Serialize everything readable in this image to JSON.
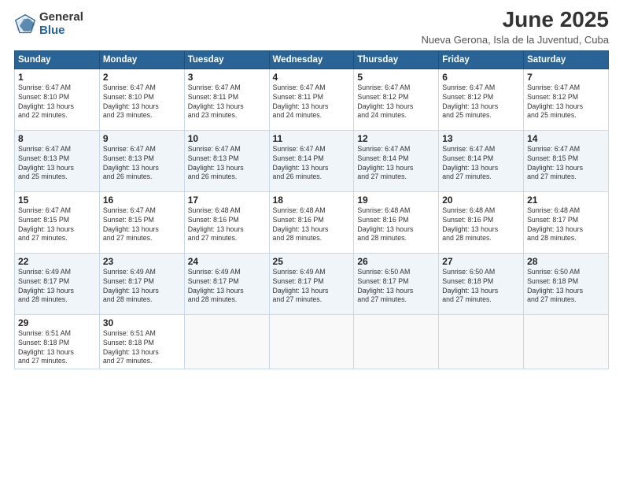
{
  "logo": {
    "general": "General",
    "blue": "Blue"
  },
  "title": "June 2025",
  "subtitle": "Nueva Gerona, Isla de la Juventud, Cuba",
  "days": [
    "Sunday",
    "Monday",
    "Tuesday",
    "Wednesday",
    "Thursday",
    "Friday",
    "Saturday"
  ],
  "weeks": [
    [
      {
        "day": "1",
        "lines": [
          "Sunrise: 6:47 AM",
          "Sunset: 8:10 PM",
          "Daylight: 13 hours",
          "and 22 minutes."
        ]
      },
      {
        "day": "2",
        "lines": [
          "Sunrise: 6:47 AM",
          "Sunset: 8:10 PM",
          "Daylight: 13 hours",
          "and 23 minutes."
        ]
      },
      {
        "day": "3",
        "lines": [
          "Sunrise: 6:47 AM",
          "Sunset: 8:11 PM",
          "Daylight: 13 hours",
          "and 23 minutes."
        ]
      },
      {
        "day": "4",
        "lines": [
          "Sunrise: 6:47 AM",
          "Sunset: 8:11 PM",
          "Daylight: 13 hours",
          "and 24 minutes."
        ]
      },
      {
        "day": "5",
        "lines": [
          "Sunrise: 6:47 AM",
          "Sunset: 8:12 PM",
          "Daylight: 13 hours",
          "and 24 minutes."
        ]
      },
      {
        "day": "6",
        "lines": [
          "Sunrise: 6:47 AM",
          "Sunset: 8:12 PM",
          "Daylight: 13 hours",
          "and 25 minutes."
        ]
      },
      {
        "day": "7",
        "lines": [
          "Sunrise: 6:47 AM",
          "Sunset: 8:12 PM",
          "Daylight: 13 hours",
          "and 25 minutes."
        ]
      }
    ],
    [
      {
        "day": "8",
        "lines": [
          "Sunrise: 6:47 AM",
          "Sunset: 8:13 PM",
          "Daylight: 13 hours",
          "and 25 minutes."
        ]
      },
      {
        "day": "9",
        "lines": [
          "Sunrise: 6:47 AM",
          "Sunset: 8:13 PM",
          "Daylight: 13 hours",
          "and 26 minutes."
        ]
      },
      {
        "day": "10",
        "lines": [
          "Sunrise: 6:47 AM",
          "Sunset: 8:13 PM",
          "Daylight: 13 hours",
          "and 26 minutes."
        ]
      },
      {
        "day": "11",
        "lines": [
          "Sunrise: 6:47 AM",
          "Sunset: 8:14 PM",
          "Daylight: 13 hours",
          "and 26 minutes."
        ]
      },
      {
        "day": "12",
        "lines": [
          "Sunrise: 6:47 AM",
          "Sunset: 8:14 PM",
          "Daylight: 13 hours",
          "and 27 minutes."
        ]
      },
      {
        "day": "13",
        "lines": [
          "Sunrise: 6:47 AM",
          "Sunset: 8:14 PM",
          "Daylight: 13 hours",
          "and 27 minutes."
        ]
      },
      {
        "day": "14",
        "lines": [
          "Sunrise: 6:47 AM",
          "Sunset: 8:15 PM",
          "Daylight: 13 hours",
          "and 27 minutes."
        ]
      }
    ],
    [
      {
        "day": "15",
        "lines": [
          "Sunrise: 6:47 AM",
          "Sunset: 8:15 PM",
          "Daylight: 13 hours",
          "and 27 minutes."
        ]
      },
      {
        "day": "16",
        "lines": [
          "Sunrise: 6:47 AM",
          "Sunset: 8:15 PM",
          "Daylight: 13 hours",
          "and 27 minutes."
        ]
      },
      {
        "day": "17",
        "lines": [
          "Sunrise: 6:48 AM",
          "Sunset: 8:16 PM",
          "Daylight: 13 hours",
          "and 27 minutes."
        ]
      },
      {
        "day": "18",
        "lines": [
          "Sunrise: 6:48 AM",
          "Sunset: 8:16 PM",
          "Daylight: 13 hours",
          "and 28 minutes."
        ]
      },
      {
        "day": "19",
        "lines": [
          "Sunrise: 6:48 AM",
          "Sunset: 8:16 PM",
          "Daylight: 13 hours",
          "and 28 minutes."
        ]
      },
      {
        "day": "20",
        "lines": [
          "Sunrise: 6:48 AM",
          "Sunset: 8:16 PM",
          "Daylight: 13 hours",
          "and 28 minutes."
        ]
      },
      {
        "day": "21",
        "lines": [
          "Sunrise: 6:48 AM",
          "Sunset: 8:17 PM",
          "Daylight: 13 hours",
          "and 28 minutes."
        ]
      }
    ],
    [
      {
        "day": "22",
        "lines": [
          "Sunrise: 6:49 AM",
          "Sunset: 8:17 PM",
          "Daylight: 13 hours",
          "and 28 minutes."
        ]
      },
      {
        "day": "23",
        "lines": [
          "Sunrise: 6:49 AM",
          "Sunset: 8:17 PM",
          "Daylight: 13 hours",
          "and 28 minutes."
        ]
      },
      {
        "day": "24",
        "lines": [
          "Sunrise: 6:49 AM",
          "Sunset: 8:17 PM",
          "Daylight: 13 hours",
          "and 28 minutes."
        ]
      },
      {
        "day": "25",
        "lines": [
          "Sunrise: 6:49 AM",
          "Sunset: 8:17 PM",
          "Daylight: 13 hours",
          "and 27 minutes."
        ]
      },
      {
        "day": "26",
        "lines": [
          "Sunrise: 6:50 AM",
          "Sunset: 8:17 PM",
          "Daylight: 13 hours",
          "and 27 minutes."
        ]
      },
      {
        "day": "27",
        "lines": [
          "Sunrise: 6:50 AM",
          "Sunset: 8:18 PM",
          "Daylight: 13 hours",
          "and 27 minutes."
        ]
      },
      {
        "day": "28",
        "lines": [
          "Sunrise: 6:50 AM",
          "Sunset: 8:18 PM",
          "Daylight: 13 hours",
          "and 27 minutes."
        ]
      }
    ],
    [
      {
        "day": "29",
        "lines": [
          "Sunrise: 6:51 AM",
          "Sunset: 8:18 PM",
          "Daylight: 13 hours",
          "and 27 minutes."
        ]
      },
      {
        "day": "30",
        "lines": [
          "Sunrise: 6:51 AM",
          "Sunset: 8:18 PM",
          "Daylight: 13 hours",
          "and 27 minutes."
        ]
      },
      {
        "day": "",
        "lines": []
      },
      {
        "day": "",
        "lines": []
      },
      {
        "day": "",
        "lines": []
      },
      {
        "day": "",
        "lines": []
      },
      {
        "day": "",
        "lines": []
      }
    ]
  ]
}
